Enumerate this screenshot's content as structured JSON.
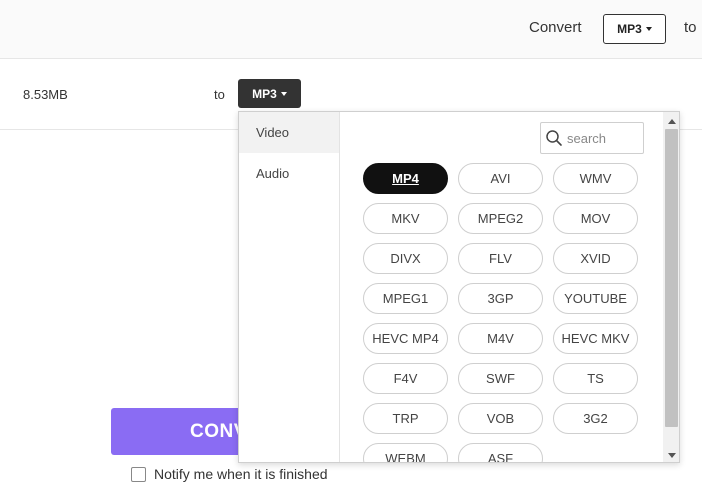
{
  "topbar": {
    "convert_label": "Convert",
    "format_button": "MP3",
    "to_label": "to"
  },
  "file": {
    "size": "8.53MB",
    "to_label": "to",
    "format_button": "MP3"
  },
  "dropdown": {
    "categories": [
      {
        "label": "Video",
        "active": true
      },
      {
        "label": "Audio",
        "active": false
      }
    ],
    "search_placeholder": "search",
    "formats": [
      "MP4",
      "AVI",
      "WMV",
      "MKV",
      "MPEG2",
      "MOV",
      "DIVX",
      "FLV",
      "XVID",
      "MPEG1",
      "3GP",
      "YOUTUBE",
      "HEVC MP4",
      "M4V",
      "HEVC MKV",
      "F4V",
      "SWF",
      "TS",
      "TRP",
      "VOB",
      "3G2",
      "WEBM",
      "ASF"
    ],
    "selected_format": "MP4"
  },
  "convert_button": "CONV",
  "notify_label": "Notify me when it is finished",
  "icons": {
    "search": "search-icon",
    "caret": "caret-down-icon"
  },
  "colors": {
    "accent": "#8a6cf3",
    "dark_button": "#333333",
    "selected_pill": "#111111"
  }
}
